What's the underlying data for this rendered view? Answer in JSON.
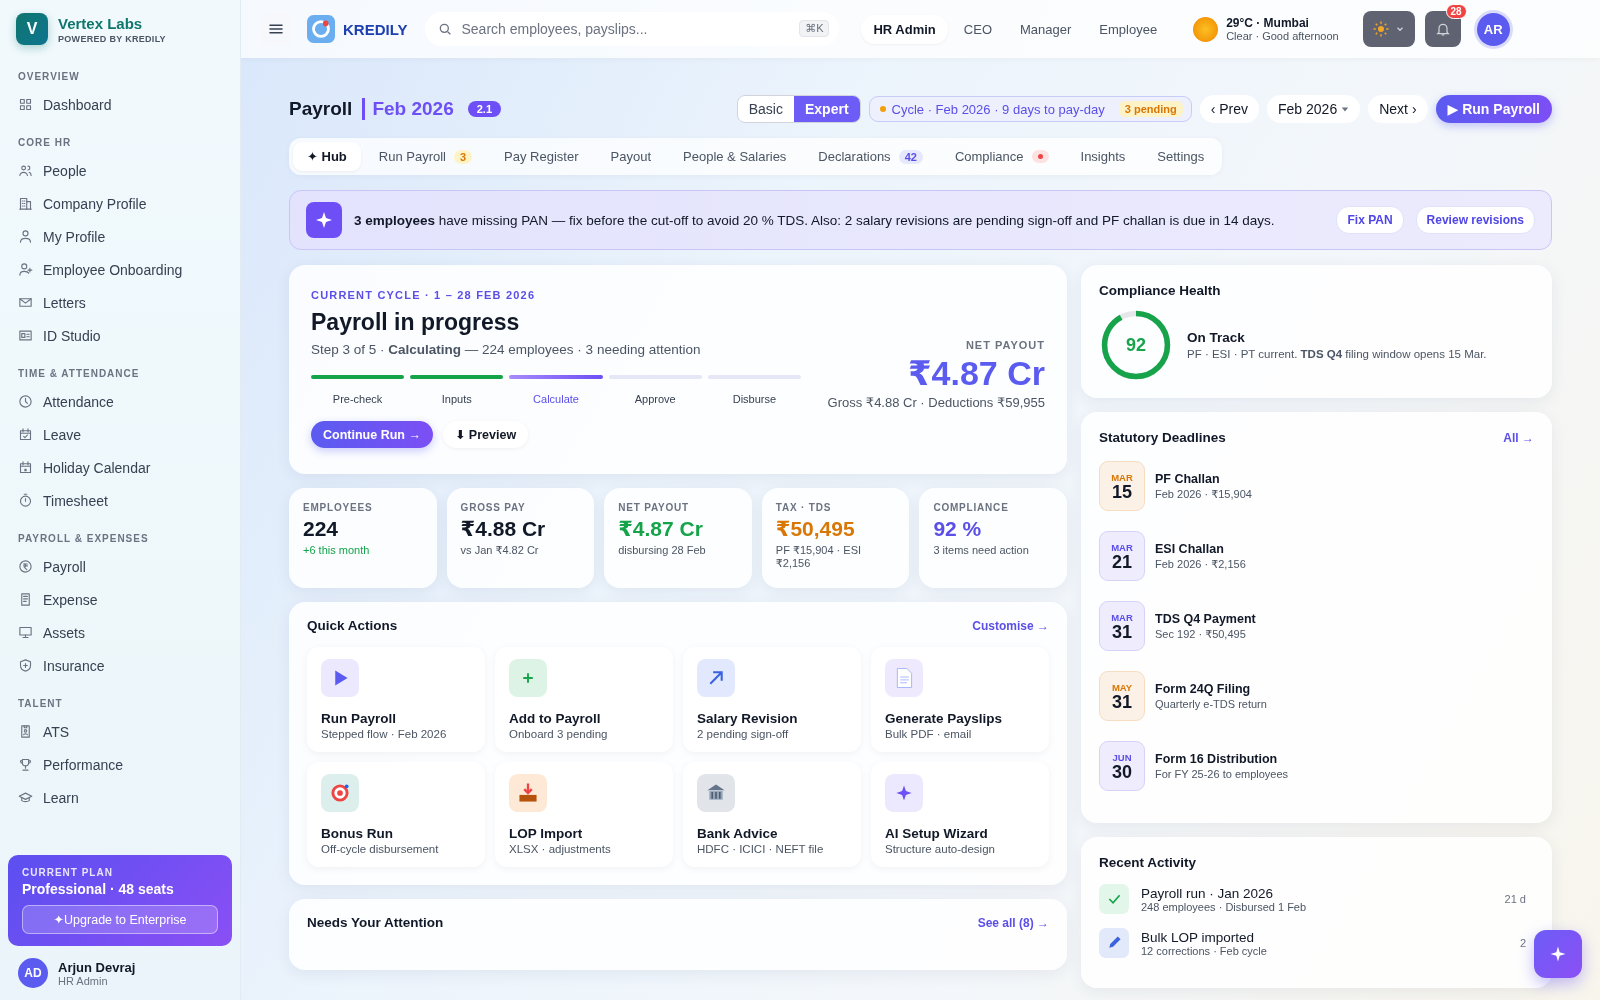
{
  "brand": {
    "initial": "V",
    "name": "Vertex Labs",
    "tagline": "POWERED BY KREDILY"
  },
  "sidebar": {
    "sections": [
      {
        "title": "OVERVIEW",
        "items": [
          {
            "label": "Dashboard"
          }
        ]
      },
      {
        "title": "CORE HR",
        "items": [
          {
            "label": "People"
          },
          {
            "label": "Company Profile"
          },
          {
            "label": "My Profile"
          },
          {
            "label": "Employee Onboarding"
          },
          {
            "label": "Letters"
          },
          {
            "label": "ID Studio"
          }
        ]
      },
      {
        "title": "TIME & ATTENDANCE",
        "items": [
          {
            "label": "Attendance"
          },
          {
            "label": "Leave"
          },
          {
            "label": "Holiday Calendar"
          },
          {
            "label": "Timesheet"
          }
        ]
      },
      {
        "title": "PAYROLL & EXPENSES",
        "items": [
          {
            "label": "Payroll"
          },
          {
            "label": "Expense"
          },
          {
            "label": "Assets"
          },
          {
            "label": "Insurance"
          }
        ]
      },
      {
        "title": "TALENT",
        "items": [
          {
            "label": "ATS"
          },
          {
            "label": "Performance"
          },
          {
            "label": "Learn"
          }
        ]
      }
    ]
  },
  "plan": {
    "caption": "CURRENT PLAN",
    "name": "Professional · 48 seats",
    "button": "✦Upgrade to Enterprise"
  },
  "user": {
    "initials": "AD",
    "name": "Arjun Devraj",
    "role": "HR Admin"
  },
  "topbar": {
    "product": "KREDILY",
    "search": {
      "placeholder": "Search employees, payslips...",
      "shortcut": "⌘K"
    },
    "roles": [
      {
        "label": "HR Admin",
        "selected": true
      },
      {
        "label": "CEO",
        "selected": false
      },
      {
        "label": "Manager",
        "selected": false
      },
      {
        "label": "Employee",
        "selected": false
      }
    ],
    "weather": {
      "temp": "29°C · Mumbai",
      "detail": "Clear · Good afternoon"
    },
    "notifications": "28",
    "avatar": "AR"
  },
  "page": {
    "title": "Payroll",
    "period": "Feb 2026",
    "version": "2.1",
    "modes": [
      {
        "label": "Basic",
        "selected": false
      },
      {
        "label": "Expert",
        "selected": true
      }
    ],
    "cycle": {
      "text": "Cycle · Feb 2026 · 9 days to pay-day",
      "badge": "3 pending"
    },
    "prev": "‹ Prev",
    "month": "Feb 2026",
    "next": "Next ›",
    "run": "▶ Run Payroll"
  },
  "tabs": [
    {
      "label": "✦ Hub",
      "selected": true
    },
    {
      "label": "Run Payroll",
      "selected": false,
      "badge": {
        "kind": "warning",
        "text": "3"
      }
    },
    {
      "label": "Pay Register",
      "selected": false
    },
    {
      "label": "Payout",
      "selected": false
    },
    {
      "label": "People & Salaries",
      "selected": false
    },
    {
      "label": "Declarations",
      "selected": false,
      "badge": {
        "kind": "info",
        "text": "42"
      }
    },
    {
      "label": "Compliance",
      "selected": false,
      "badge": {
        "kind": "alert"
      }
    },
    {
      "label": "Insights",
      "selected": false
    },
    {
      "label": "Settings",
      "selected": false
    }
  ],
  "banner": {
    "text": "**3 employees** have missing PAN — fix before the cut-off to avoid 20 % TDS. Also: 2 salary revisions are pending sign-off and PF challan is due in 14 days.",
    "actions": [
      "Fix PAN",
      "Review revisions"
    ]
  },
  "cycle_card": {
    "eyebrow": "CURRENT CYCLE · 1 – 28 FEB 2026",
    "title": "Payroll in progress",
    "summary": "Step 3 of 5 · **Calculating** — 224 employees · 3 needing attention",
    "steps": [
      {
        "label": "Pre-check",
        "kind": "done"
      },
      {
        "label": "Inputs",
        "kind": "done"
      },
      {
        "label": "Calculate",
        "kind": "current"
      },
      {
        "label": "Approve",
        "kind": "pending"
      },
      {
        "label": "Disburse",
        "kind": "pending"
      }
    ],
    "primary": "Continue Run →",
    "secondary": "⬇ Preview",
    "net_label": "NET PAYOUT",
    "net_value": "₹4.87 Cr",
    "net_detail": "Gross ₹4.88 Cr · Deductions ₹59,955"
  },
  "stats": [
    {
      "label": "EMPLOYEES",
      "value": "224",
      "note": "+6 this month",
      "color": "#111827",
      "kind": "growth"
    },
    {
      "label": "GROSS PAY",
      "value": "₹4.88 Cr",
      "note": "vs Jan ₹4.82 Cr",
      "color": "#111827",
      "kind": "plain"
    },
    {
      "label": "NET PAYOUT",
      "value": "₹4.87 Cr",
      "note": "disbursing 28 Feb",
      "color": "#16a34a",
      "kind": "plain"
    },
    {
      "label": "TAX · TDS",
      "value": "₹50,495",
      "note": "PF ₹15,904 · ESI ₹2,156",
      "color": "#d97706",
      "kind": "plain"
    },
    {
      "label": "COMPLIANCE",
      "value": "92 %",
      "note": "3 items need action",
      "color": "#5b4fe8",
      "kind": "plain"
    }
  ],
  "quick_actions": {
    "title": "Quick Actions",
    "link": "Customise →",
    "items": [
      {
        "title": "Run Payroll",
        "subtitle": "Stepped flow · Feb 2026",
        "color": "#ece9fe"
      },
      {
        "title": "Add to Payroll",
        "subtitle": "Onboard 3 pending",
        "color": "#dcf3e6"
      },
      {
        "title": "Salary Revision",
        "subtitle": "2 pending sign-off",
        "color": "#e2e8fd"
      },
      {
        "title": "Generate Payslips",
        "subtitle": "Bulk PDF · email",
        "color": "#efe9fd"
      },
      {
        "title": "Bonus Run",
        "subtitle": "Off-cycle disbursement",
        "color": "#dcefec"
      },
      {
        "title": "LOP Import",
        "subtitle": "XLSX · adjustments",
        "color": "#fde9d6"
      },
      {
        "title": "Bank Advice",
        "subtitle": "HDFC · ICICI · NEFT file",
        "color": "#e1e4e8"
      },
      {
        "title": "AI Setup Wizard",
        "subtitle": "Structure auto-design",
        "color": "#ece9fe"
      }
    ]
  },
  "attention": {
    "title": "Needs Your Attention",
    "link": "See all (8) →"
  },
  "compliance_health": {
    "title": "Compliance Health",
    "score": "92",
    "level": 0.92,
    "status": "On Track",
    "detail": "PF · ESI · PT current. **TDS Q4** filing window opens 15 Mar."
  },
  "deadlines": {
    "title": "Statutory Deadlines",
    "link": "All →",
    "items": [
      {
        "month": "MAR",
        "day": "15",
        "title": "PF Challan",
        "detail": "Feb 2026 · ₹15,904",
        "color": "#d97706"
      },
      {
        "month": "MAR",
        "day": "21",
        "title": "ESI Challan",
        "detail": "Feb 2026 · ₹2,156",
        "color": "#5b4fe8"
      },
      {
        "month": "MAR",
        "day": "31",
        "title": "TDS Q4 Payment",
        "detail": "Sec 192 · ₹50,495",
        "color": "#5b4fe8"
      },
      {
        "month": "MAY",
        "day": "31",
        "title": "Form 24Q Filing",
        "detail": "Quarterly e-TDS return",
        "color": "#d97706"
      },
      {
        "month": "JUN",
        "day": "30",
        "title": "Form 16 Distribution",
        "detail": "For FY 25-26 to employees",
        "color": "#5b4fe8"
      }
    ]
  },
  "activity": {
    "title": "Recent Activity",
    "items": [
      {
        "title": "Payroll run · Jan 2026",
        "detail": "248 employees · Disbursed 1 Feb",
        "time": "21 d",
        "kind": "success"
      },
      {
        "title": "Bulk LOP imported",
        "detail": "12 corrections · Feb cycle",
        "time": "2",
        "kind": "edit"
      }
    ]
  }
}
